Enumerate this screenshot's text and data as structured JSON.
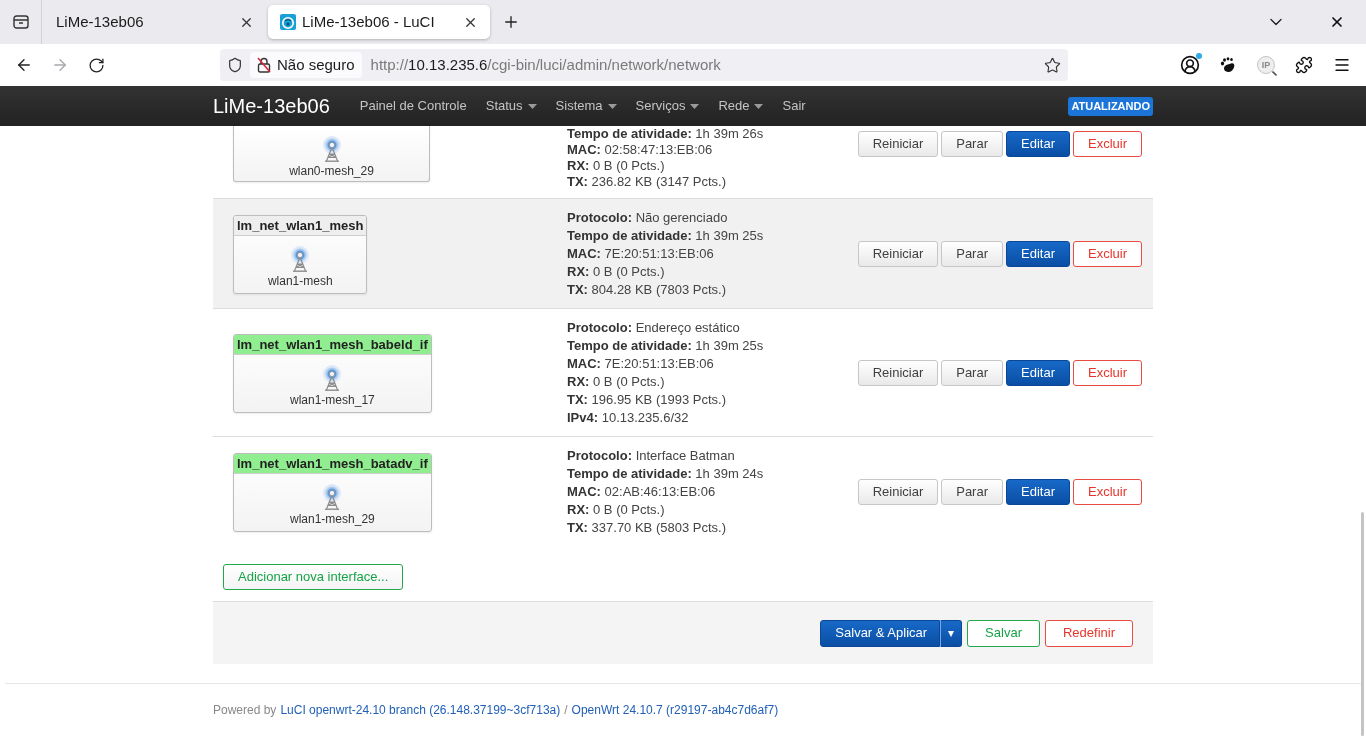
{
  "browser": {
    "tabs": [
      {
        "title": "LiMe-13eb06",
        "selected": false
      },
      {
        "title": "LiMe-13eb06 - LuCI",
        "selected": true
      }
    ],
    "security_label": "Não seguro",
    "url": {
      "scheme": "http://",
      "host": "10.13.235.6",
      "path": "/cgi-bin/luci/admin/network/network"
    },
    "extension_label": "IP"
  },
  "navbar": {
    "brand": "LiMe-13eb06",
    "menu": [
      {
        "label": "Painel de Controle",
        "has_menu": false
      },
      {
        "label": "Status",
        "has_menu": true
      },
      {
        "label": "Sistema",
        "has_menu": true
      },
      {
        "label": "Serviços",
        "has_menu": true
      },
      {
        "label": "Rede",
        "has_menu": true
      },
      {
        "label": "Sair",
        "has_menu": false
      }
    ],
    "badge": "ATUALIZANDO"
  },
  "interfaces": [
    {
      "device": "wlan0-mesh_29",
      "highlighted": false,
      "details": [
        {
          "label": "Tempo de atividade:",
          "value": "1h 39m 26s"
        },
        {
          "label": "MAC:",
          "value": "02:58:47:13:EB:06"
        },
        {
          "label": "RX:",
          "value": "0 B (0 Pcts.)"
        },
        {
          "label": "TX:",
          "value": "236.82 KB (3147 Pcts.)"
        }
      ],
      "actions": [
        {
          "label": "Reiniciar",
          "kind": "default"
        },
        {
          "label": "Parar",
          "kind": "default"
        },
        {
          "label": "Editar",
          "kind": "primary"
        },
        {
          "label": "Excluir",
          "kind": "danger"
        }
      ]
    },
    {
      "name": "lm_net_wlan1_mesh",
      "color": "#eeeeee",
      "device": "wlan1-mesh",
      "highlighted": true,
      "details": [
        {
          "label": "Protocolo:",
          "value": "Não gerenciado"
        },
        {
          "label": "Tempo de atividade:",
          "value": "1h 39m 25s"
        },
        {
          "label": "MAC:",
          "value": "7E:20:51:13:EB:06"
        },
        {
          "label": "RX:",
          "value": "0 B (0 Pcts.)"
        },
        {
          "label": "TX:",
          "value": "804.28 KB (7803 Pcts.)"
        }
      ],
      "actions": [
        {
          "label": "Reiniciar",
          "kind": "default"
        },
        {
          "label": "Parar",
          "kind": "default"
        },
        {
          "label": "Editar",
          "kind": "primary"
        },
        {
          "label": "Excluir",
          "kind": "danger"
        }
      ]
    },
    {
      "name": "lm_net_wlan1_mesh_babeld_if",
      "color": "#90ee90",
      "device": "wlan1-mesh_17",
      "highlighted": false,
      "details": [
        {
          "label": "Protocolo:",
          "value": "Endereço estático"
        },
        {
          "label": "Tempo de atividade:",
          "value": "1h 39m 25s"
        },
        {
          "label": "MAC:",
          "value": "7E:20:51:13:EB:06"
        },
        {
          "label": "RX:",
          "value": "0 B (0 Pcts.)"
        },
        {
          "label": "TX:",
          "value": "196.95 KB (1993 Pcts.)"
        },
        {
          "label": "IPv4:",
          "value": "10.13.235.6/32"
        }
      ],
      "actions": [
        {
          "label": "Reiniciar",
          "kind": "default"
        },
        {
          "label": "Parar",
          "kind": "default"
        },
        {
          "label": "Editar",
          "kind": "primary"
        },
        {
          "label": "Excluir",
          "kind": "danger"
        }
      ]
    },
    {
      "name": "lm_net_wlan1_mesh_batadv_if",
      "color": "#90ee90",
      "device": "wlan1-mesh_29",
      "highlighted": false,
      "details": [
        {
          "label": "Protocolo:",
          "value": "Interface Batman"
        },
        {
          "label": "Tempo de atividade:",
          "value": "1h 39m 24s"
        },
        {
          "label": "MAC:",
          "value": "02:AB:46:13:EB:06"
        },
        {
          "label": "RX:",
          "value": "0 B (0 Pcts.)"
        },
        {
          "label": "TX:",
          "value": "337.70 KB (5803 Pcts.)"
        }
      ],
      "actions": [
        {
          "label": "Reiniciar",
          "kind": "default"
        },
        {
          "label": "Parar",
          "kind": "default"
        },
        {
          "label": "Editar",
          "kind": "primary"
        },
        {
          "label": "Excluir",
          "kind": "danger"
        }
      ]
    }
  ],
  "add_button": "Adicionar nova interface...",
  "form_actions": [
    {
      "label": "Salvar & Aplicar",
      "kind": "primary",
      "menu_glyph": "▾"
    },
    {
      "label": "Salvar",
      "kind": "positive"
    },
    {
      "label": "Redefinir",
      "kind": "danger"
    }
  ],
  "footer": {
    "prefix": "Powered by",
    "luci_link": "LuCI openwrt-24.10 branch (26.148.37199~3cf713a)",
    "separator": "/",
    "openwrt_link": "OpenWrt 24.10.7 (r29197-ab4c7d6af7)"
  }
}
